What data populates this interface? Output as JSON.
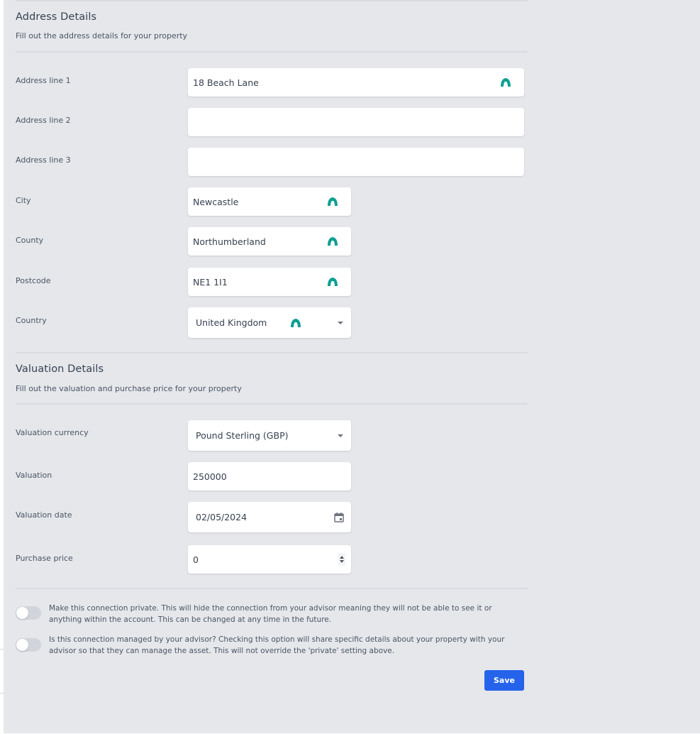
{
  "address_section": {
    "title": "Address Details",
    "description": "Fill out the address details for your property",
    "fields": [
      {
        "label": "Address line 1",
        "value": "18 Beach Lane",
        "autofill_icon": "autofill-icon"
      },
      {
        "label": "Address line 2",
        "value": ""
      },
      {
        "label": "Address line 3",
        "value": ""
      },
      {
        "label": "City",
        "value": "Newcastle",
        "autofill_icon": "autofill-icon"
      },
      {
        "label": "County",
        "value": "Northumberland",
        "autofill_icon": "autofill-icon"
      },
      {
        "label": "Postcode",
        "value": "NE1 1I1",
        "autofill_icon": "autofill-icon"
      },
      {
        "label": "Country",
        "value": "United Kingdom",
        "autofill_icon": "autofill-icon",
        "type": "select"
      }
    ]
  },
  "valuation_section": {
    "title": "Valuation Details",
    "description": "Fill out the valuation and purchase price for your property",
    "fields": [
      {
        "label": "Valuation currency",
        "value": "Pound Sterling (GBP)",
        "type": "select"
      },
      {
        "label": "Valuation",
        "value": "250000"
      },
      {
        "label": "Valuation date",
        "value": "02/05/2024",
        "type": "date"
      },
      {
        "label": "Purchase price",
        "value": "0",
        "type": "number"
      }
    ]
  },
  "toggles": [
    {
      "text": "Make this connection private. This will hide the connection from your advisor meaning they will not be able to see it or anything within the account. This can be changed at any time in the future.",
      "checked": false
    },
    {
      "text": "Is this connection managed by your advisor? Checking this option will share specific details about your property with your advisor so that they can manage the asset. This will not override the 'private' setting above.",
      "checked": false
    }
  ],
  "actions": {
    "save_label": "Save"
  },
  "colors": {
    "primary": "#2563eb",
    "autofill": "#0f9f94",
    "background": "#e5e7eb"
  }
}
